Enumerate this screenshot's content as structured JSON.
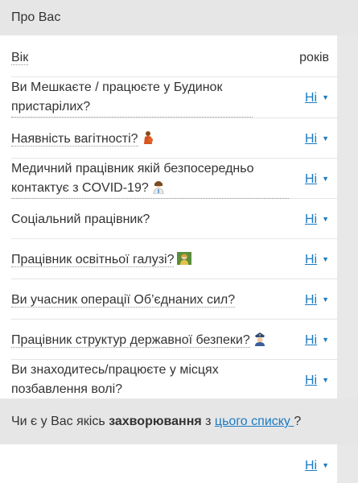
{
  "header": {
    "title": "Про Вас"
  },
  "age": {
    "label": "Вік",
    "unit": "років"
  },
  "questions": [
    {
      "text": "Ви Мешкаєте / працюєте у Будинок пристарілих?",
      "answer": "Ні"
    },
    {
      "text": "Наявність вагітності?",
      "answer": "Ні",
      "icon": "pregnant-woman-icon"
    },
    {
      "text": "Медичний працівник якій безпосередньо контактує з COVID-19?",
      "answer": "Ні",
      "icon": "health-worker-icon"
    },
    {
      "text": "Соціальний працівник?",
      "answer": "Ні"
    },
    {
      "text": "Працівник освітньої галузі?",
      "answer": "Ні",
      "icon": "teacher-icon"
    },
    {
      "text": "Ви учасник операції Об’єднаних сил?",
      "answer": "Ні"
    },
    {
      "text": "Працівник структур державної безпеки?",
      "answer": "Ні",
      "icon": "police-officer-icon"
    },
    {
      "text": "Ви знаходитесь/працюєте у місцях позбавлення волі?",
      "answer": "Ні"
    }
  ],
  "diseases": {
    "prefix": "Чи є у Вас якісь ",
    "bold": "захворювання",
    "middle": " з ",
    "link": "цього списку ",
    "suffix": "?",
    "answer": "Ні"
  }
}
